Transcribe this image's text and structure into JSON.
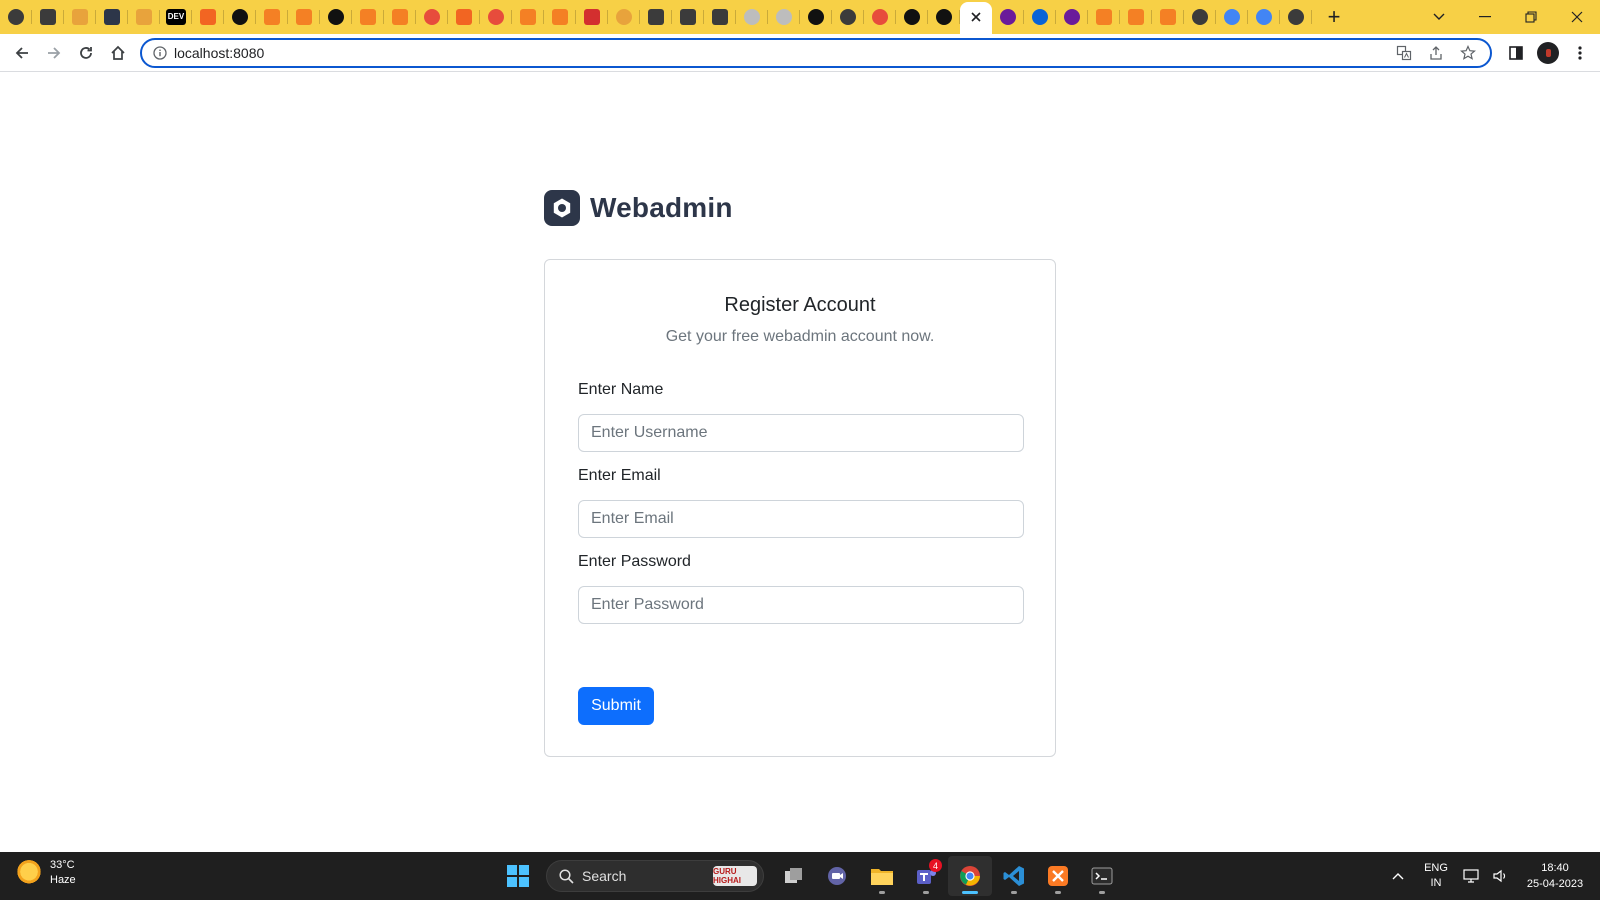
{
  "browser": {
    "tabs": [
      {
        "icon": "hexagon-icon",
        "color": "#3b3b3b"
      },
      {
        "icon": "film-icon",
        "color": "#3b3b3b"
      },
      {
        "icon": "gear-icon",
        "color": "#e8a33c"
      },
      {
        "icon": "webadmin-icon",
        "color": "#2d3649"
      },
      {
        "icon": "pma-icon",
        "color": "#e8a33c"
      },
      {
        "icon": "dev-icon",
        "color": "#000000",
        "text": "DEV"
      },
      {
        "icon": "box-icon",
        "color": "#f26522"
      },
      {
        "icon": "circle-icon",
        "color": "#111111"
      },
      {
        "icon": "stack-icon",
        "color": "#f48024"
      },
      {
        "icon": "stack-icon",
        "color": "#f48024"
      },
      {
        "icon": "circle-icon",
        "color": "#111111"
      },
      {
        "icon": "stack-icon",
        "color": "#f48024"
      },
      {
        "icon": "stack-icon",
        "color": "#f48024"
      },
      {
        "icon": "red-circle-icon",
        "color": "#e74c3c"
      },
      {
        "icon": "shield-icon",
        "color": "#f26522"
      },
      {
        "icon": "red-circle-icon",
        "color": "#e74c3c"
      },
      {
        "icon": "stack-icon",
        "color": "#f48024"
      },
      {
        "icon": "stack-icon",
        "color": "#f48024"
      },
      {
        "icon": "red-square-icon",
        "color": "#d32f2f"
      },
      {
        "icon": "github-icon",
        "color": "#e8a33c"
      },
      {
        "icon": "film-icon",
        "color": "#3b3b3b"
      },
      {
        "icon": "film-icon",
        "color": "#3b3b3b"
      },
      {
        "icon": "film-icon",
        "color": "#3b3b3b"
      },
      {
        "icon": "gray-circle-icon",
        "color": "#bdbdbd"
      },
      {
        "icon": "gray-circle-icon",
        "color": "#bdbdbd"
      },
      {
        "icon": "circle-icon",
        "color": "#111111"
      },
      {
        "icon": "hexagon-icon",
        "color": "#3b3b3b"
      },
      {
        "icon": "red-circle-icon",
        "color": "#e74c3c"
      },
      {
        "icon": "circle-icon",
        "color": "#111111"
      },
      {
        "icon": "circle-icon",
        "color": "#111111"
      },
      {
        "icon": "close-icon",
        "color": "#202124",
        "active": true
      },
      {
        "icon": "u-icon",
        "color": "#6a1b9a"
      },
      {
        "icon": "outlook-icon",
        "color": "#0a64d6"
      },
      {
        "icon": "u-icon",
        "color": "#6a1b9a"
      },
      {
        "icon": "stack-icon",
        "color": "#f48024"
      },
      {
        "icon": "stack-icon",
        "color": "#f48024"
      },
      {
        "icon": "stack-icon",
        "color": "#f48024"
      },
      {
        "icon": "hexagon-icon",
        "color": "#3b3b3b"
      },
      {
        "icon": "google-icon",
        "color": "#4285f4"
      },
      {
        "icon": "google-icon",
        "color": "#4285f4"
      },
      {
        "icon": "hexagon-icon",
        "color": "#3b3b3b"
      }
    ],
    "address": "localhost:8080",
    "accent": "#0b57d0",
    "tabstrip_color": "#f7d046"
  },
  "page": {
    "brand": "Webadmin",
    "card": {
      "title": "Register Account",
      "subtitle": "Get your free webadmin account now.",
      "name_label": "Enter Name",
      "name_placeholder": "Enter Username",
      "email_label": "Enter Email",
      "email_placeholder": "Enter Email",
      "password_label": "Enter Password",
      "password_placeholder": "Enter Password",
      "submit_label": "Submit"
    },
    "colors": {
      "primary": "#0d6efd",
      "brand": "#2d3649"
    }
  },
  "taskbar": {
    "weather_temp": "33°C",
    "weather_desc": "Haze",
    "search_label": "Search",
    "search_badge": "GURU HIGHAI",
    "teams_badge": "4",
    "lang_top": "ENG",
    "lang_bottom": "IN",
    "time": "18:40",
    "date": "25-04-2023"
  }
}
